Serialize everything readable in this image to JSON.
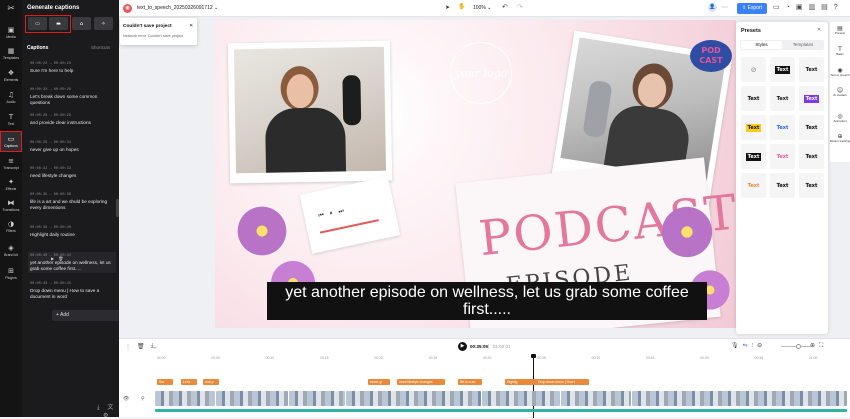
{
  "rail": [
    {
      "label": "Media",
      "icon": "media-icon",
      "glyph": "▣"
    },
    {
      "label": "Templates",
      "icon": "templates-icon",
      "glyph": "▦"
    },
    {
      "label": "Elements",
      "icon": "elements-icon",
      "glyph": "❖"
    },
    {
      "label": "Audio",
      "icon": "audio-icon",
      "glyph": "♫"
    },
    {
      "label": "Text",
      "icon": "text-icon",
      "glyph": "T"
    },
    {
      "label": "Captions",
      "icon": "captions-icon",
      "glyph": "▭"
    },
    {
      "label": "Transcript",
      "icon": "transcript-icon",
      "glyph": "≡"
    },
    {
      "label": "Effects",
      "icon": "effects-icon",
      "glyph": "✦"
    },
    {
      "label": "Transitions",
      "icon": "transitions-icon",
      "glyph": "⧓"
    },
    {
      "label": "Filters",
      "icon": "filters-icon",
      "glyph": "◑"
    },
    {
      "label": "Brand kit",
      "icon": "brand-kit-icon",
      "glyph": "◈"
    },
    {
      "label": "Plugins",
      "icon": "plugins-icon",
      "glyph": "⊞"
    }
  ],
  "panel": {
    "title": "Generate captions",
    "tab_captions": "Captions",
    "tab_shortcuts": "Shortcuts",
    "add_label": "Add",
    "captions": [
      {
        "time": "00:00:22 → 00:00:23",
        "text": "Sure I'm here to help"
      },
      {
        "time": "00:00:24 → 00:00:28",
        "text": "Let's break down some common questions"
      },
      {
        "time": "00:00:28 → 00:00:29",
        "text": "and provide clear instructions"
      },
      {
        "time": "00:00:29 → 00:00:31",
        "text": "never give up on hopes"
      },
      {
        "time": "00:00:32 → 00:00:33",
        "text": "need lifestyle changes"
      },
      {
        "time": "00:00:35 → 00:00:38",
        "text": "life is a art and we shuld be exploring every dimentions"
      },
      {
        "time": "00:00:38 → 00:00:40",
        "text": "Highlight daily routine"
      },
      {
        "time": "00:00:40 → 00:00:42",
        "text": "yet another episode on wellness, let us grab some coffee first....."
      },
      {
        "time": "00:00:43 → 00:00:45",
        "text": "Drop down menu | How to save a document in word"
      }
    ]
  },
  "topbar": {
    "project_name": "text_to_speech_20250326091712",
    "zoom": "100%",
    "export_label": "Export"
  },
  "toast": {
    "title": "Couldn't save project",
    "message": "Network error. Couldn't save project"
  },
  "canvas": {
    "logo_text": "your logo",
    "badge_text": "POD CAST",
    "podcast_word": "PODCAST",
    "episode_word": "EPISODE",
    "subtitle": "yet another episode on wellness, let us grab some coffee first....."
  },
  "presets": {
    "title": "Presets",
    "tab_styles": "Styles",
    "tab_templates": "Templates",
    "sample": "Text"
  },
  "right_rail": [
    {
      "label": "Presets",
      "icon": "presets-icon",
      "glyph": "▤"
    },
    {
      "label": "Basic",
      "icon": "basic-icon",
      "glyph": "T"
    },
    {
      "label": "Text to speech",
      "icon": "text-to-speech-icon",
      "glyph": "◉"
    },
    {
      "label": "AI avatars",
      "icon": "ai-avatars-icon",
      "glyph": "☺"
    },
    {
      "label": "Animation",
      "icon": "animation-icon",
      "glyph": "◎"
    },
    {
      "label": "Motion tracking",
      "icon": "motion-tracking-icon",
      "glyph": "⊕"
    }
  ],
  "timeline": {
    "current_time": "00:35:05",
    "total_time": "01:02:01",
    "ticks": [
      "00:00",
      "00:05",
      "00:10",
      "00:15",
      "00:20",
      "00:25",
      "00:30",
      "00:35",
      "00:40",
      "00:45",
      "00:50",
      "00:55",
      "01:00"
    ],
    "caption_clips": [
      "Sur",
      "Let's",
      "and p",
      "never gi",
      "need lifestyle changes",
      "life is a art",
      "Highlig",
      "Drop down menu | How t"
    ]
  },
  "colors": {
    "accent": "#3b82f6",
    "highlight_box": "#e21b1b",
    "clip_orange": "#e98a3a",
    "canvas_pink": "#f5d9e0"
  }
}
